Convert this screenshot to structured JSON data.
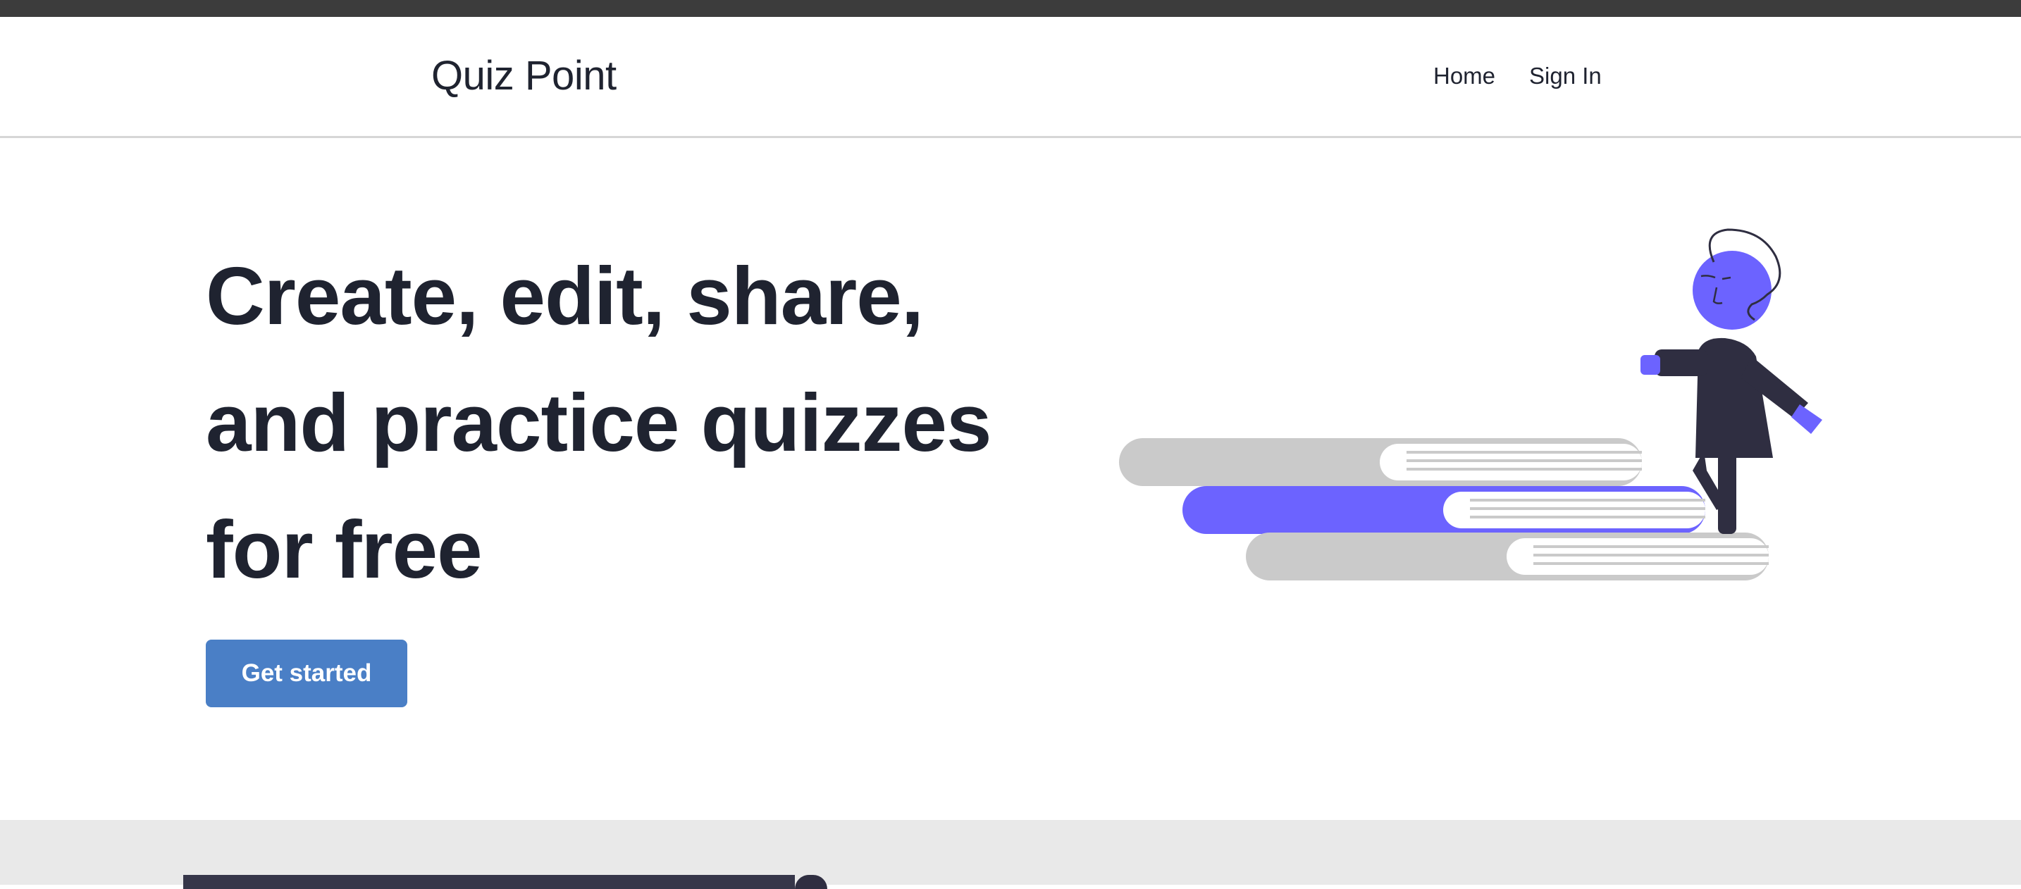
{
  "navbar": {
    "brand": "Quiz Point",
    "links": [
      {
        "label": "Home"
      },
      {
        "label": "Sign In"
      }
    ]
  },
  "hero": {
    "title_lines": [
      "Create, edit, share,",
      "and practice quizzes",
      "for free"
    ],
    "cta_label": "Get started",
    "illustration": "person-climbing-books-illustration"
  },
  "colors": {
    "accent": "#6c63ff",
    "button": "#4a7fc6",
    "text": "#1f2330",
    "book_gray": "#cacaca",
    "figure_dark": "#2f2e41",
    "topbar": "#3c3c3c",
    "section_bg": "#e9e9e9"
  }
}
